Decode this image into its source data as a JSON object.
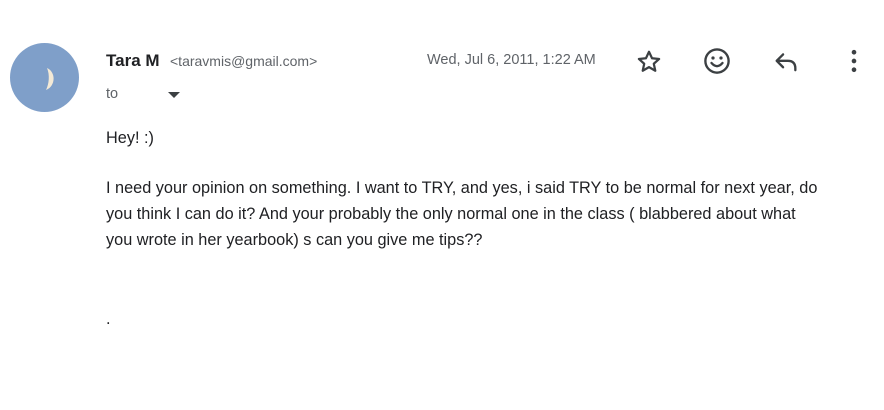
{
  "email": {
    "sender_name": "Tara M",
    "sender_email": "<taravmis@gmail.com>",
    "timestamp": "Wed, Jul 6, 2011, 1:22 AM",
    "to_label": "to",
    "greeting": "Hey! :)",
    "body_lines": [
      "I need your opinion on something. I want to TRY, and yes, i said TRY to be normal for next year, do",
      "you think I can do it? And your probably the only normal one in the class (       blabbered about what",
      "you wrote in her yearbook) s can you give me tips??"
    ],
    "closing": "."
  },
  "colors": {
    "avatar_bg": "#7f9fc9",
    "text": "#202124",
    "secondary_text": "#5f6368",
    "icon": "#3c4043"
  },
  "icons": {
    "star": "star-icon",
    "emoji": "emoji-icon",
    "reply": "reply-icon",
    "more": "more-vert-icon",
    "dropdown": "caret-down-icon",
    "avatar": "moon-icon"
  }
}
